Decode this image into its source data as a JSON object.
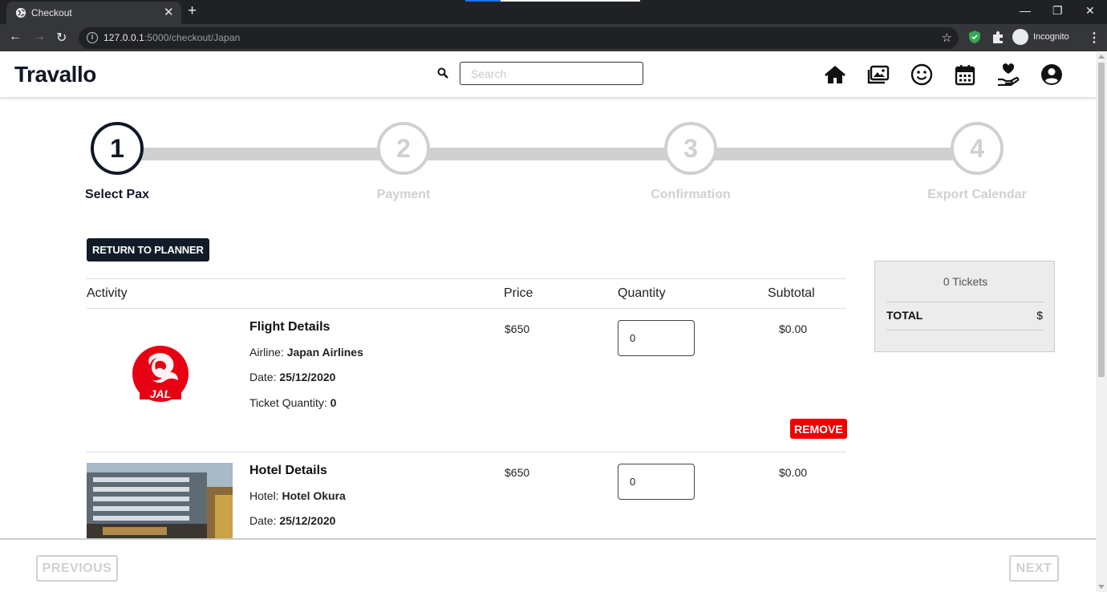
{
  "browser": {
    "tab_title": "Checkout",
    "url_host": "127.0.0.1",
    "url_rest": ":5000/checkout/Japan",
    "incognito_label": "Incognito"
  },
  "nav": {
    "logo": "Travallo",
    "search_placeholder": "Search",
    "icons": [
      "home-icon",
      "gallery-icon",
      "smiley-icon",
      "calendar-icon",
      "donate-icon",
      "account-icon"
    ]
  },
  "steps": [
    {
      "number": "1",
      "label": "Select Pax",
      "active": true
    },
    {
      "number": "2",
      "label": "Payment",
      "active": false
    },
    {
      "number": "3",
      "label": "Confirmation",
      "active": false
    },
    {
      "number": "4",
      "label": "Export Calendar",
      "active": false
    }
  ],
  "return_button": "RETURN TO PLANNER",
  "table": {
    "headers": {
      "activity": "Activity",
      "price": "Price",
      "quantity": "Quantity",
      "subtotal": "Subtotal"
    },
    "rows": [
      {
        "title": "Flight Details",
        "field1_label": "Airline: ",
        "field1_value": "Japan Airlines",
        "date_label": "Date: ",
        "date_value": "25/12/2020",
        "qty_label": "Ticket Quantity: ",
        "qty_value": "0",
        "price": "$650",
        "quantity": "0",
        "subtotal": "$0.00",
        "remove": "REMOVE",
        "logo_text": "JAL"
      },
      {
        "title": "Hotel Details",
        "field1_label": "Hotel: ",
        "field1_value": "Hotel Okura",
        "date_label": "Date: ",
        "date_value": "25/12/2020",
        "price": "$650",
        "quantity": "0",
        "subtotal": "$0.00"
      }
    ]
  },
  "summary": {
    "tickets": "0 Tickets",
    "total_label": "TOTAL",
    "total_value": "$"
  },
  "footer": {
    "previous": "PREVIOUS",
    "next": "NEXT"
  },
  "colors": {
    "primary_dark": "#111827",
    "remove_red": "#f20000",
    "inactive_grey": "#d0d0d0"
  }
}
